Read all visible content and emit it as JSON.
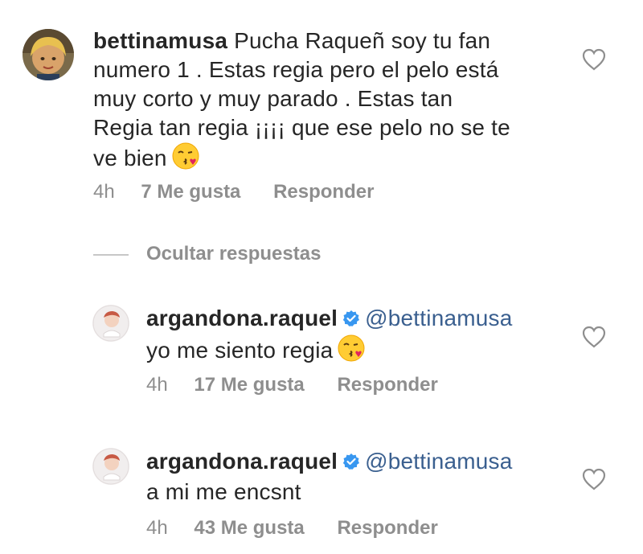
{
  "comment": {
    "username": "bettinamusa",
    "text_lines": [
      "Pucha Raqueñ soy tu fan",
      "numero 1 . Estas regia pero el pelo está",
      "muy corto y muy parado . Estas tan",
      "Regia tan regia ¡¡¡¡ que ese pelo no se te",
      "ve bien"
    ],
    "time": "4h",
    "likes": "7 Me gusta",
    "reply_label": "Responder"
  },
  "replies_toggle": "Ocultar respuestas",
  "replies": [
    {
      "username": "argandona.raquel",
      "mention": "@bettinamusa",
      "text": "yo me siento regia",
      "time": "4h",
      "likes": "17 Me gusta",
      "reply_label": "Responder"
    },
    {
      "username": "argandona.raquel",
      "mention": "@bettinamusa",
      "text": "a mi me encsnt",
      "time": "4h",
      "likes": "43 Me gusta",
      "reply_label": "Responder"
    }
  ],
  "colors": {
    "text": "#262626",
    "meta": "#8e8e8e",
    "mention": "#3a5f8f",
    "verified": "#3897f0"
  },
  "icons": [
    "heart-outline-icon",
    "verified-badge-icon",
    "kissing-face-emoji",
    "avatar"
  ]
}
